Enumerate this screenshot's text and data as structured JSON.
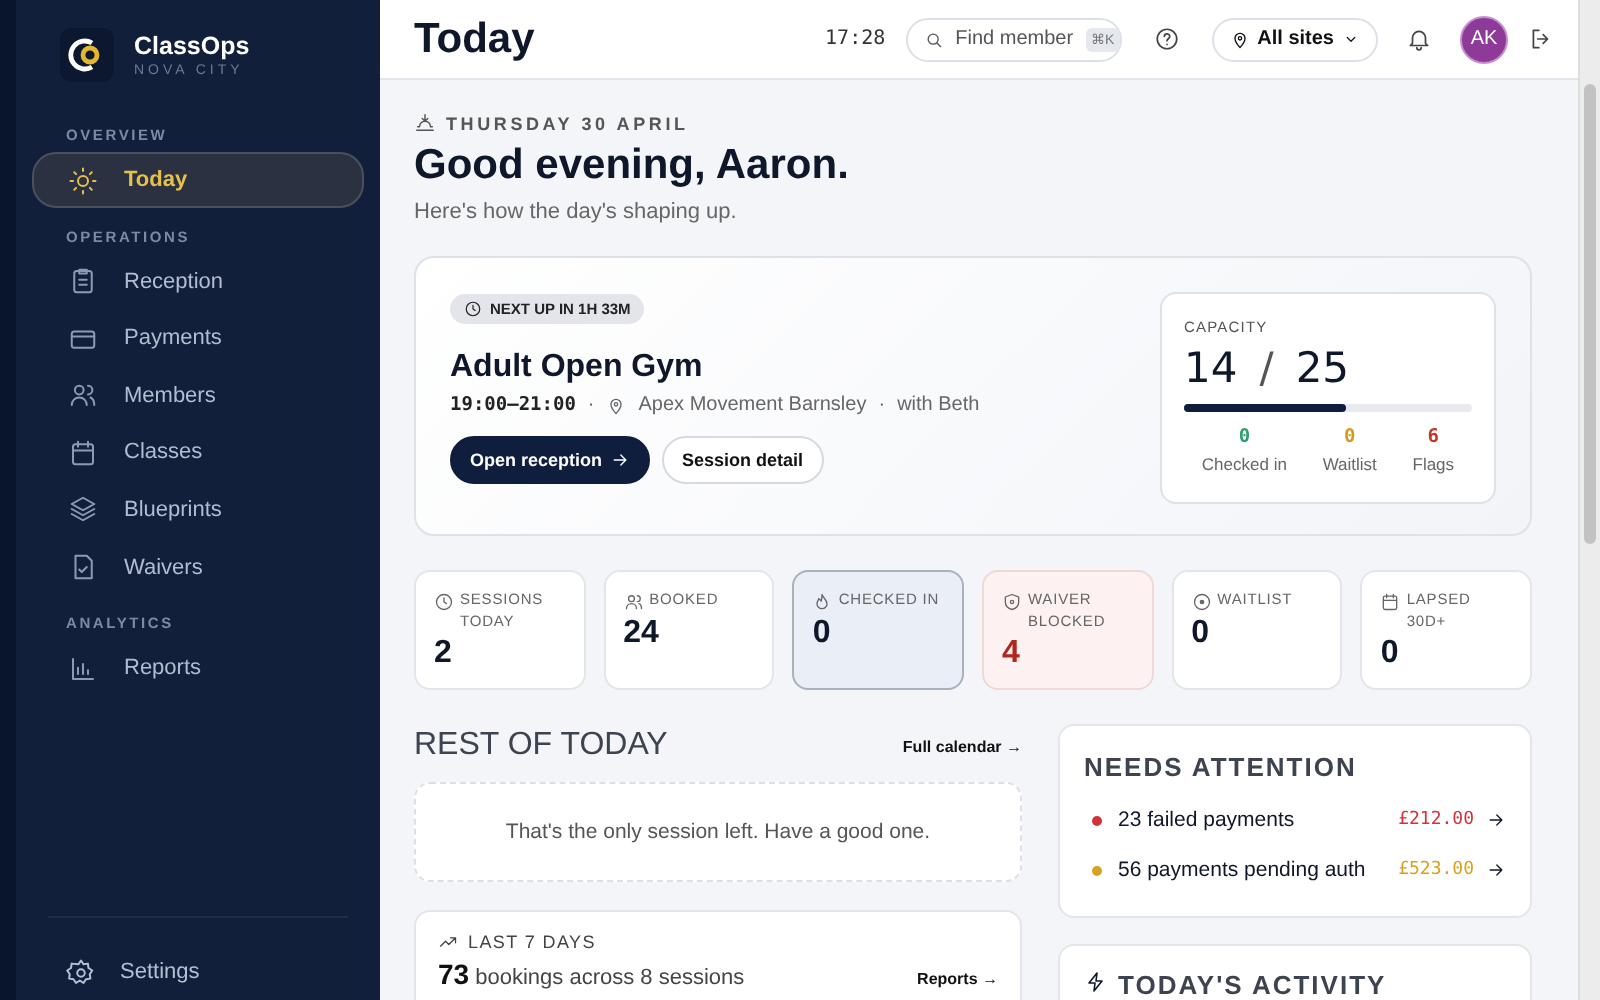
{
  "brand": {
    "name": "ClassOps",
    "subtitle": "NOVA CITY"
  },
  "sidebar": {
    "sections": [
      {
        "heading": "OVERVIEW",
        "items": [
          {
            "label": "Today",
            "selected": true
          }
        ]
      },
      {
        "heading": "OPERATIONS",
        "items": [
          {
            "label": "Reception",
            "selected": false
          },
          {
            "label": "Payments",
            "selected": false
          },
          {
            "label": "Members",
            "selected": false
          },
          {
            "label": "Classes",
            "selected": false
          },
          {
            "label": "Blueprints",
            "selected": false
          },
          {
            "label": "Waivers",
            "selected": false
          }
        ]
      },
      {
        "heading": "ANALYTICS",
        "items": [
          {
            "label": "Reports",
            "selected": false
          }
        ]
      }
    ],
    "footer": {
      "label": "Settings"
    }
  },
  "header": {
    "title": "Today",
    "time": "17:28",
    "search": {
      "placeholder": "Find member",
      "shortcut": "⌘K"
    },
    "site": "All sites",
    "avatar": "AK"
  },
  "greeting": {
    "date": "THURSDAY 30 APRIL",
    "title": "Good evening, Aaron.",
    "subtitle": "Here's how the day's shaping up."
  },
  "next_session": {
    "badge": "NEXT UP IN 1H 33M",
    "name": "Adult Open Gym",
    "time": "19:00–21:00",
    "location": "Apex Movement Barnsley",
    "instructor": "with Beth",
    "separator": "·",
    "buttons": [
      {
        "label": "Open reception",
        "kind": "primary"
      },
      {
        "label": "Session detail",
        "kind": "secondary"
      }
    ],
    "capacity": {
      "label": "CAPACITY",
      "booked": "14",
      "separator": "/",
      "total": "25",
      "level": 0.56,
      "counts": [
        {
          "value": "0",
          "label": "Checked in",
          "color": "#2e9e6a"
        },
        {
          "value": "0",
          "label": "Waitlist",
          "color": "#d49a1e"
        },
        {
          "value": "6",
          "label": "Flags",
          "color": "#c0392b"
        }
      ]
    }
  },
  "stats": [
    {
      "label": "SESSIONS TODAY",
      "value": "2",
      "kind": "normal"
    },
    {
      "label": "BOOKED",
      "value": "24",
      "kind": "normal"
    },
    {
      "label": "CHECKED IN",
      "value": "0",
      "kind": "highlight"
    },
    {
      "label": "WAIVER BLOCKED",
      "value": "4",
      "kind": "alert"
    },
    {
      "label": "WAITLIST",
      "value": "0",
      "kind": "normal"
    },
    {
      "label": "LAPSED 30D+",
      "value": "0",
      "kind": "normal"
    }
  ],
  "rest_of_today": {
    "title": "REST OF TODAY",
    "link": "Full calendar →",
    "empty": "That's the only session left. Have a good one."
  },
  "last_7_days": {
    "label": "LAST 7 DAYS",
    "count": "73",
    "text": "bookings across 8 sessions",
    "link": "Reports →"
  },
  "needs_attention": {
    "title": "NEEDS ATTENTION",
    "items": [
      {
        "label": "23 failed payments",
        "amount": "£212.00",
        "color": "#d0343a"
      },
      {
        "label": "56 payments pending auth",
        "amount": "£523.00",
        "color": "#d9a21e"
      }
    ]
  },
  "activity": {
    "title": "TODAY'S ACTIVITY"
  }
}
